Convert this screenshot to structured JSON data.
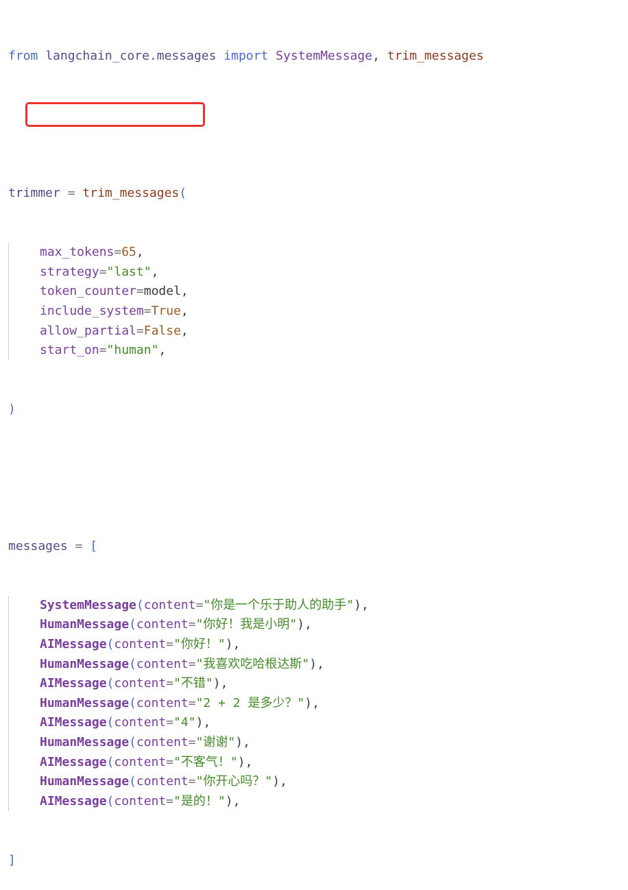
{
  "line1": {
    "kw_from": "from",
    "module": "langchain_core.messages",
    "kw_import": "import",
    "cls": "SystemMessage",
    "comma": ",",
    "fn": "trim_messages"
  },
  "trimmer": {
    "var": "trimmer",
    "eq": "=",
    "fn": "trim_messages",
    "open": "(",
    "args": [
      {
        "name": "max_tokens",
        "eq": "=",
        "value": "65",
        "value_kind": "num",
        "tail": ","
      },
      {
        "name": "strategy",
        "eq": "=",
        "value": "\"last\"",
        "value_kind": "str",
        "tail": ","
      },
      {
        "name": "token_counter",
        "eq": "=",
        "value": "model",
        "value_kind": "plain",
        "tail": ","
      },
      {
        "name": "include_system",
        "eq": "=",
        "value": "True",
        "value_kind": "kwc",
        "tail": ","
      },
      {
        "name": "allow_partial",
        "eq": "=",
        "value": "False",
        "value_kind": "kwc",
        "tail": ","
      },
      {
        "name": "start_on",
        "eq": "=",
        "value": "\"human\"",
        "value_kind": "str",
        "tail": ","
      }
    ],
    "close": ")"
  },
  "messages": {
    "var": "messages",
    "eq": "=",
    "open": "[",
    "items": [
      {
        "cls": "SystemMessage",
        "arg": "content",
        "value": "\"你是一个乐于助人的助手\"",
        "tail": "),"
      },
      {
        "cls": "HumanMessage",
        "arg": "content",
        "value": "\"你好！我是小明\"",
        "tail": "),"
      },
      {
        "cls": "AIMessage",
        "arg": "content",
        "value": "\"你好！\"",
        "tail": "),"
      },
      {
        "cls": "HumanMessage",
        "arg": "content",
        "value": "\"我喜欢吃哈根达斯\"",
        "tail": "),"
      },
      {
        "cls": "AIMessage",
        "arg": "content",
        "value": "\"不错\"",
        "tail": "),"
      },
      {
        "cls": "HumanMessage",
        "arg": "content",
        "value": "\"2 + 2 是多少？\"",
        "tail": "),"
      },
      {
        "cls": "AIMessage",
        "arg": "content",
        "value": "\"4\"",
        "tail": "),"
      },
      {
        "cls": "HumanMessage",
        "arg": "content",
        "value": "\"谢谢\"",
        "tail": "),"
      },
      {
        "cls": "AIMessage",
        "arg": "content",
        "value": "\"不客气！\"",
        "tail": "),"
      },
      {
        "cls": "HumanMessage",
        "arg": "content",
        "value": "\"你开心吗？\"",
        "tail": "),"
      },
      {
        "cls": "AIMessage",
        "arg": "content",
        "value": "\"是的！\"",
        "tail": "),"
      }
    ],
    "close": "]"
  },
  "colors": {
    "highlight_box": "#e8322c"
  }
}
